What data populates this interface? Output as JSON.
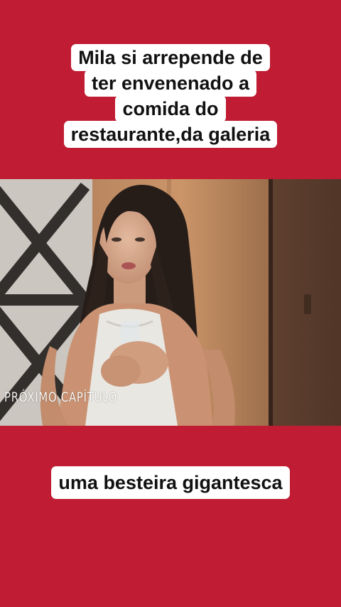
{
  "caption_top": {
    "lines": [
      "Mila si arrepende de",
      "ter envenenado a",
      "comida do",
      "restaurante,da galeria"
    ]
  },
  "video": {
    "overlay_text": "PRÓXIMO CAPÍTULO"
  },
  "caption_bottom": {
    "text": "uma besteira gigantesca"
  },
  "colors": {
    "background": "#c01c33",
    "caption_box": "#ffffff",
    "caption_text": "#111111"
  }
}
